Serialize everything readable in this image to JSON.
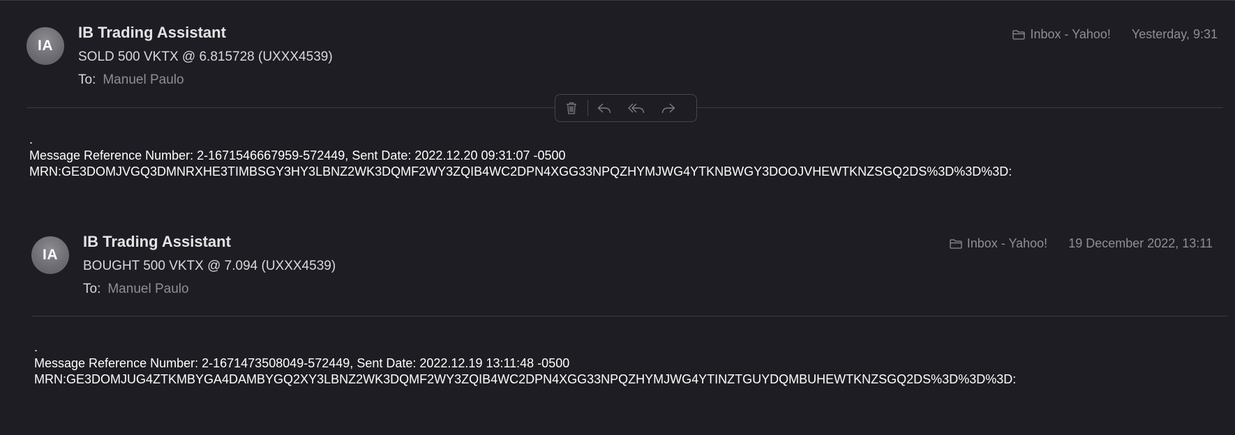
{
  "messages": [
    {
      "avatar_initials": "IA",
      "sender": "IB Trading Assistant",
      "subject": "SOLD 500 VKTX @ 6.815728 (UXXX4539)",
      "to_label": "To:",
      "to_name": "Manuel Paulo",
      "folder": "Inbox - Yahoo!",
      "folder_icon": "folder-icon",
      "date": "Yesterday, 9:31",
      "body_dot": ".",
      "body_line1": "Message Reference Number: 2-1671546667959-572449, Sent Date: 2022.12.20 09:31:07 -0500",
      "body_line2": "MRN:GE3DOMJVGQ3DMNRXHE3TIMBSGY3HY3LBNZ2WK3DQMF2WY3ZQIB4WC2DPN4XGG33NPQZHYMJWG4YTKNBWGY3DOOJVHEWTKNZSGQ2DS%3D%3D%3D:"
    },
    {
      "avatar_initials": "IA",
      "sender": "IB Trading Assistant",
      "subject": "BOUGHT 500 VKTX @ 7.094 (UXXX4539)",
      "to_label": "To:",
      "to_name": "Manuel Paulo",
      "folder": "Inbox - Yahoo!",
      "folder_icon": "folder-icon",
      "date": "19 December 2022, 13:11",
      "body_dot": ".",
      "body_line1": "Message Reference Number: 2-1671473508049-572449, Sent Date: 2022.12.19 13:11:48 -0500",
      "body_line2": "MRN:GE3DOMJUG4ZTKMBYGA4DAMBYGQ2XY3LBNZ2WK3DQMF2WY3ZQIB4WC2DPN4XGG33NPQZHYMJWG4YTINZTGUYDQMBUHEWTKNZSGQ2DS%3D%3D%3D:"
    }
  ],
  "toolbar": {
    "icons": [
      "trash-icon",
      "reply-icon",
      "reply-all-icon",
      "forward-icon"
    ]
  },
  "colors": {
    "background": "#1e1d23",
    "divider": "#3b3a41",
    "muted_text": "#8e8e93",
    "avatar": "#6f6e74"
  }
}
